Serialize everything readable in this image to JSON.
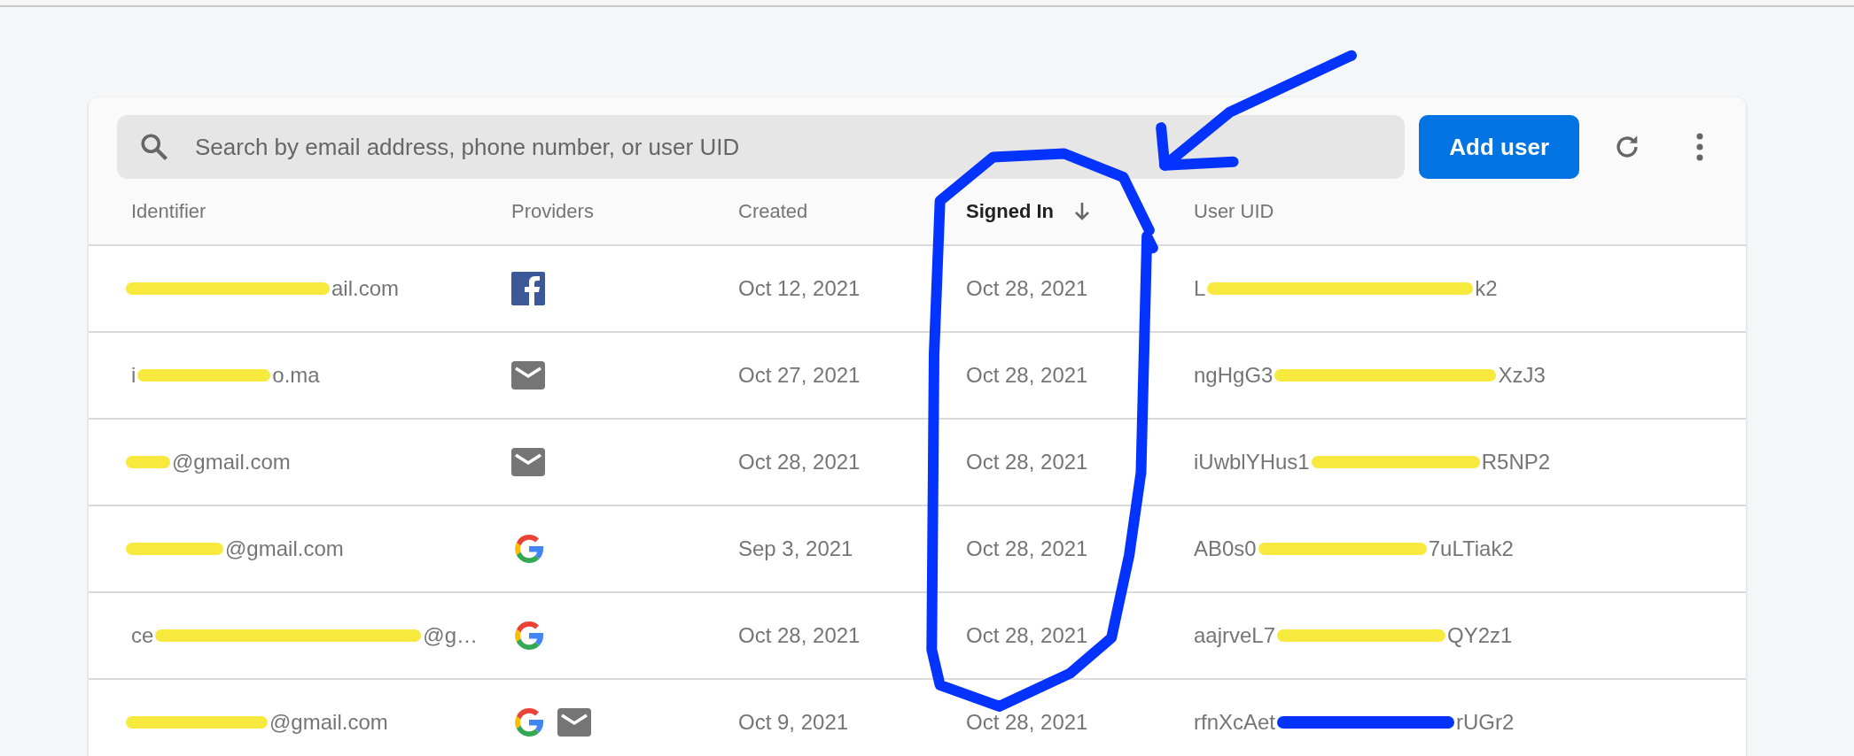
{
  "toolbar": {
    "search": {
      "placeholder": "Search by email address, phone number, or user UID"
    },
    "add_button": "Add user"
  },
  "table": {
    "columns": [
      {
        "label": "Identifier",
        "sorted": false
      },
      {
        "label": "Providers",
        "sorted": false
      },
      {
        "label": "Created",
        "sorted": false
      },
      {
        "label": "Signed In",
        "sorted": true
      },
      {
        "label": "User UID",
        "sorted": false
      }
    ],
    "rows": [
      {
        "identifier": {
          "end": "ail.com",
          "color": "#f8e93f"
        },
        "providers": [
          {
            "kind": "facebook"
          }
        ],
        "created": "Oct 12, 2021",
        "signed_in": "Oct 28, 2021",
        "uid": {
          "start": "L",
          "end": "k2",
          "color": "#f8e93f"
        }
      },
      {
        "identifier": {
          "start": "i",
          "end": "o.ma",
          "color": "#f8e93f"
        },
        "providers": [
          {
            "kind": "email"
          }
        ],
        "created": "Oct 27, 2021",
        "signed_in": "Oct 28, 2021",
        "uid": {
          "start": "ngHgG3",
          "end": "XzJ3",
          "color": "#f8e93f"
        }
      },
      {
        "identifier": {
          "end": "@gmail.com",
          "color": "#f8e93f"
        },
        "providers": [
          {
            "kind": "email"
          }
        ],
        "created": "Oct 28, 2021",
        "signed_in": "Oct 28, 2021",
        "uid": {
          "start": "iUwblYHus1",
          "end": "R5NP2",
          "color": "#f8e93f"
        }
      },
      {
        "identifier": {
          "end": "@gmail.com",
          "color": "#f8e93f"
        },
        "providers": [
          {
            "kind": "google"
          }
        ],
        "created": "Sep 3, 2021",
        "signed_in": "Oct 28, 2021",
        "uid": {
          "start": "AB0s0",
          "end": "7uLTiak2",
          "color": "#f8e93f"
        }
      },
      {
        "identifier": {
          "start": "ce",
          "end": "@g…",
          "color": "#f8e93f"
        },
        "providers": [
          {
            "kind": "google"
          }
        ],
        "created": "Oct 28, 2021",
        "signed_in": "Oct 28, 2021",
        "uid": {
          "start": "aajrveL7",
          "end": "QY2z1",
          "color": "#f8e93f"
        }
      },
      {
        "identifier": {
          "end": "@gmail.com",
          "color": "#f8e93f"
        },
        "providers": [
          {
            "kind": "google"
          },
          {
            "kind": "email"
          }
        ],
        "created": "Oct 9, 2021",
        "signed_in": "Oct 28, 2021",
        "uid": {
          "start": "rfnXcAet",
          "end": "rUGr2",
          "color": "#0433ff"
        }
      }
    ]
  }
}
